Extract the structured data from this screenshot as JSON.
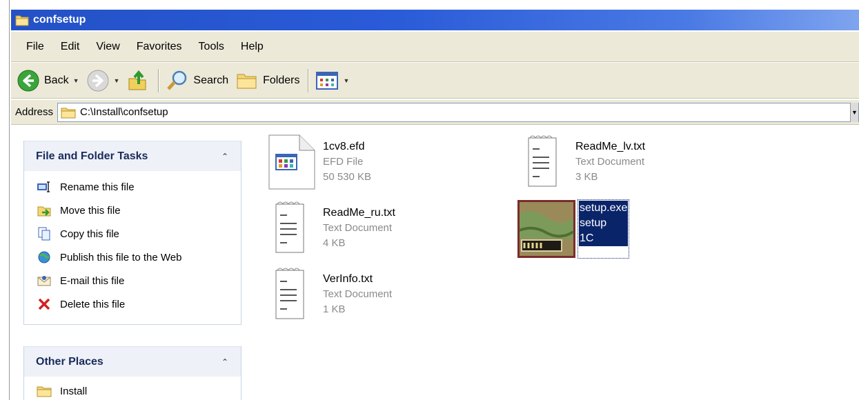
{
  "window": {
    "title": "confsetup"
  },
  "menu": [
    "File",
    "Edit",
    "View",
    "Favorites",
    "Tools",
    "Help"
  ],
  "toolbar": {
    "back_label": "Back",
    "search_label": "Search",
    "folders_label": "Folders"
  },
  "address": {
    "label": "Address",
    "path": "C:\\Install\\confsetup"
  },
  "tasks_panel": {
    "title": "File and Folder Tasks",
    "items": [
      {
        "label": "Rename this file",
        "icon": "rename-icon"
      },
      {
        "label": "Move this file",
        "icon": "move-icon"
      },
      {
        "label": "Copy this file",
        "icon": "copy-icon"
      },
      {
        "label": "Publish this file to the Web",
        "icon": "publish-web-icon"
      },
      {
        "label": "E-mail this file",
        "icon": "email-icon"
      },
      {
        "label": "Delete this file",
        "icon": "delete-icon"
      }
    ]
  },
  "places_panel": {
    "title": "Other Places",
    "items": [
      {
        "label": "Install",
        "icon": "folder-icon"
      }
    ]
  },
  "files": [
    {
      "name": "1cv8.efd",
      "type": "EFD File",
      "size": "50 530 KB",
      "icon": "efd-file-icon"
    },
    {
      "name": "ReadMe_lv.txt",
      "type": "Text Document",
      "size": "3 KB",
      "icon": "text-document-icon"
    },
    {
      "name": "ReadMe_ru.txt",
      "type": "Text Document",
      "size": "4 KB",
      "icon": "text-document-icon"
    },
    {
      "name": "setup.exe",
      "type": "setup",
      "size": "1C",
      "icon": "setup-exe-icon",
      "selected": true
    },
    {
      "name": "VerInfo.txt",
      "type": "Text Document",
      "size": "1 KB",
      "icon": "text-document-icon"
    }
  ],
  "colors": {
    "title_bar": "#2351c7",
    "chrome": "#ece9d8",
    "selection": "#0a246a",
    "panel_head": "#eef1f7"
  }
}
